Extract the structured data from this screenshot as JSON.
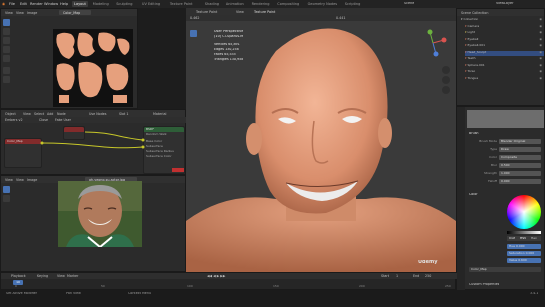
{
  "menu": [
    "File",
    "Edit",
    "Render",
    "Window",
    "Help"
  ],
  "workspace_tabs": [
    {
      "label": "Layout",
      "active": true
    },
    {
      "label": "Modeling",
      "active": false
    },
    {
      "label": "Sculpting",
      "active": false
    },
    {
      "label": "UV Editing",
      "active": false
    },
    {
      "label": "Texture Paint",
      "active": false
    },
    {
      "label": "Shading",
      "active": false
    },
    {
      "label": "Animation",
      "active": false
    },
    {
      "label": "Rendering",
      "active": false
    },
    {
      "label": "Compositing",
      "active": false
    },
    {
      "label": "Geometry Nodes",
      "active": false
    },
    {
      "label": "Scripting",
      "active": false
    }
  ],
  "scene": {
    "scene_label": "Scene",
    "layer_label": "ViewLayer"
  },
  "image_editor": {
    "header": [
      "View",
      "View",
      "Image"
    ],
    "image_name": "Color_Map"
  },
  "node_editor": {
    "header": [
      "Object",
      "View",
      "Select",
      "Add",
      "Node"
    ],
    "use_nodes": "Use Nodes",
    "slot": "Slot 1",
    "material": "Material",
    "sub_header": [
      "Embers v2",
      "Close",
      "Fake User"
    ],
    "node_top": "Principled",
    "image_node_label": "Color_Map",
    "mix_rows": [
      "Base Color",
      "Subsurface",
      "Subsurface Radius",
      "Subsurface Color"
    ],
    "bsdf_rows": [
      "BSDF",
      "Random Walk"
    ],
    "bsdf_header": "BSDF"
  },
  "ref_image": {
    "header": [
      "View",
      "View",
      "Image"
    ],
    "image_name": "oh-yeong-su-actor.jpg",
    "caption": "Reference photo of a smiling elderly man"
  },
  "viewport": {
    "header": [
      "Texture Paint",
      "View",
      "Texture Paint"
    ],
    "mode_tabs": [
      "Image",
      "Texture Slots",
      "Brush",
      "Texture",
      "Texture Mask",
      "Stroke",
      "Falloff",
      "Cursor",
      "Options"
    ],
    "overlay_title": "User Perspective",
    "overlay_subtitle": "(10) Cl-Sparus.M",
    "stats": [
      {
        "label": "Vertices",
        "value": "65,891"
      },
      {
        "label": "Edges",
        "value": "130,258"
      },
      {
        "label": "Faces",
        "value": "65,535"
      },
      {
        "label": "Triangles",
        "value": "130,958"
      }
    ],
    "brush_values": [
      "0.462",
      "0.441"
    ],
    "axis_labels": [
      "X",
      "Y",
      "Z"
    ]
  },
  "outliner": {
    "title": "Scene Collection",
    "items": [
      {
        "label": "Collection",
        "indent": 0,
        "color": "#d0d0d0"
      },
      {
        "label": "Camera",
        "indent": 1,
        "color": "#e07a5f"
      },
      {
        "label": "Light",
        "indent": 1,
        "color": "#e0c95f"
      },
      {
        "label": "Eyeball",
        "indent": 1,
        "color": "#e07a5f"
      },
      {
        "label": "Eyeball.001",
        "indent": 1,
        "color": "#e07a5f"
      },
      {
        "label": "Head_Sculpt",
        "indent": 1,
        "color": "#e07a5f",
        "selected": true
      },
      {
        "label": "Teeth",
        "indent": 1,
        "color": "#e07a5f"
      },
      {
        "label": "Sphere.001",
        "indent": 1,
        "color": "#e07a5f"
      },
      {
        "label": "Torso",
        "indent": 1,
        "color": "#e07a5f"
      },
      {
        "label": "Tongue",
        "indent": 1,
        "color": "#e07a5f"
      }
    ]
  },
  "properties": {
    "texture_label": "Texture",
    "brush_section": "Brush",
    "rows": [
      {
        "label": "Brush Mode",
        "value": "Blender Original"
      },
      {
        "label": "Type",
        "value": "Draw"
      },
      {
        "label": "Color",
        "value": "Composite"
      },
      {
        "label": "Blur",
        "value": "0.500"
      },
      {
        "label": "Strength",
        "value": "1.000"
      },
      {
        "label": "Falloff",
        "value": "0.000"
      }
    ],
    "color_section": "Color",
    "hsv_labels": [
      "RGB",
      "HSV",
      "Hex"
    ],
    "picker_rows": [
      {
        "label": "Hue",
        "value": "0.000"
      },
      {
        "label": "Saturation",
        "value": "0.000"
      },
      {
        "label": "Value",
        "value": "0.600"
      }
    ],
    "bottom": "Custom Properties",
    "active_slot": "Color_Map"
  },
  "timeline": {
    "header": [
      "Playback",
      "Keying",
      "View",
      "Marker"
    ],
    "start_label": "Start",
    "start": "1",
    "end_label": "End",
    "end": "250",
    "current": "10",
    "ticks": [
      "0",
      "50",
      "100",
      "150",
      "200",
      "250"
    ]
  },
  "status_bar": {
    "items": [
      "Set Active Modifier",
      "Pan View",
      "Context Menu"
    ],
    "version": "3.4.1"
  },
  "watermark": "Udemy",
  "colors": {
    "accent": "#4772b3",
    "skin": "#e6a07d",
    "selected_row": "#334d80",
    "orange_socket": "#c7c729",
    "node_color_header": "#822b2b"
  }
}
